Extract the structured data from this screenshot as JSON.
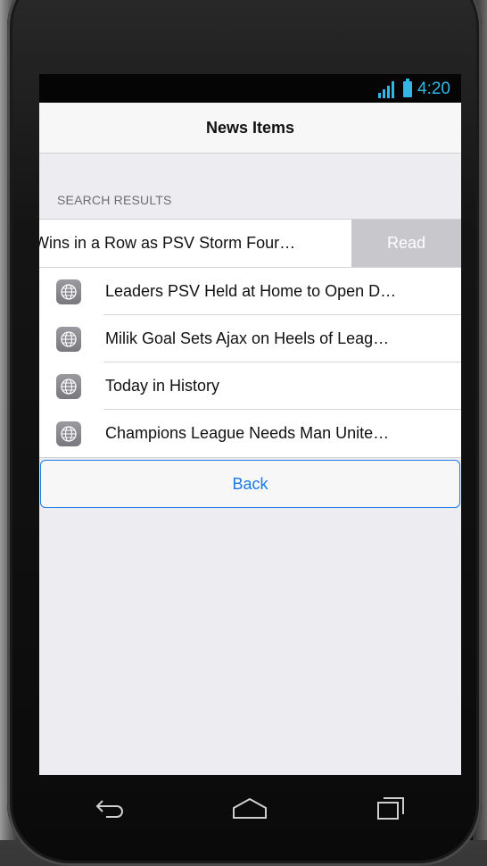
{
  "status": {
    "time": "4:20",
    "accent": "#33b5e5"
  },
  "nav": {
    "title": "News Items"
  },
  "section": {
    "header": "SEARCH RESULTS"
  },
  "swiped_row": {
    "text": "Wins in a Row as PSV Storm Four…",
    "action": "Read"
  },
  "items": [
    {
      "icon": "globe-icon",
      "title": "Leaders PSV Held at Home to Open D…"
    },
    {
      "icon": "globe-icon",
      "title": "Milik Goal Sets Ajax on Heels of Leag…"
    },
    {
      "icon": "globe-icon",
      "title": "Today in History"
    },
    {
      "icon": "globe-icon",
      "title": "Champions League Needs Man Unite…"
    }
  ],
  "back_button": {
    "label": "Back",
    "color": "#1a7ae6"
  },
  "system_nav": {
    "back": "back-icon",
    "home": "home-icon",
    "recents": "recents-icon"
  }
}
